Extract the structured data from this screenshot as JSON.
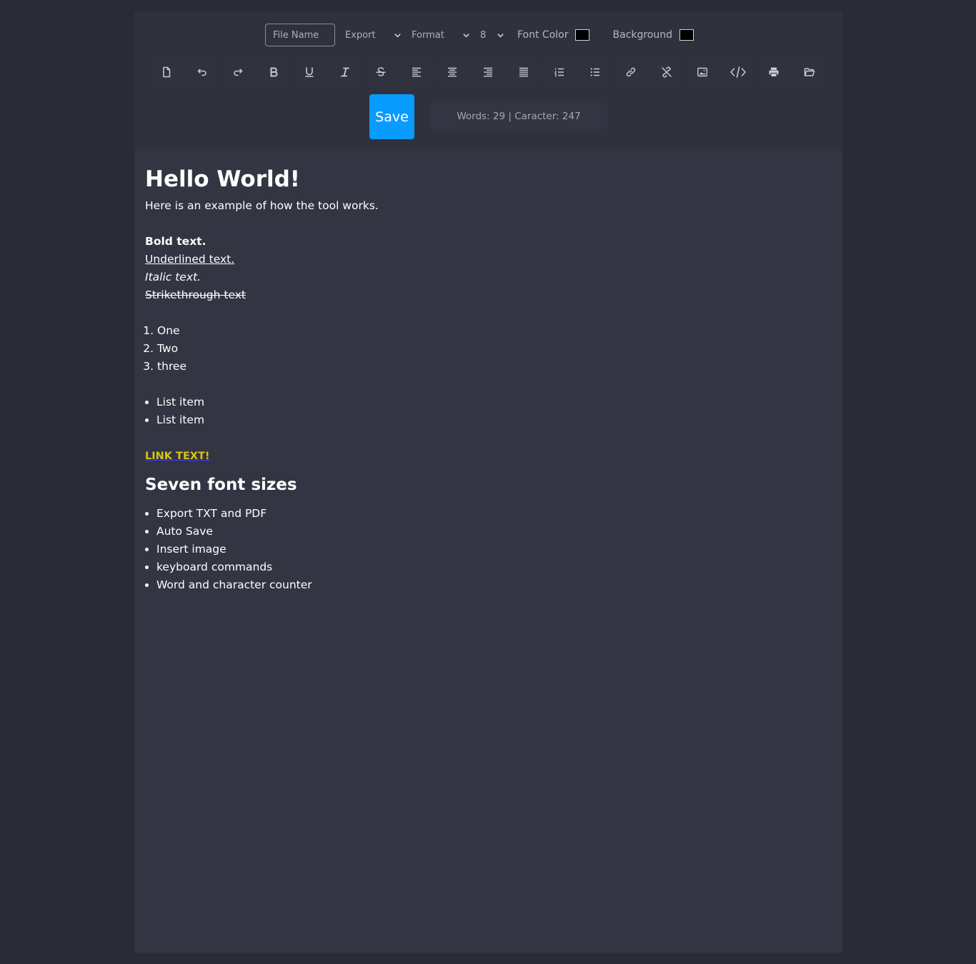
{
  "toolbar": {
    "file_name_placeholder": "File Name",
    "export_label": "Export",
    "format_label": "Format",
    "font_size_value": "8",
    "font_color_label": "Font Color",
    "font_color_value": "#000000",
    "background_label": "Background",
    "background_value": "#000000",
    "save_label": "Save",
    "counter_text": "Words: 29 | Caracter: 247"
  },
  "colors": {
    "page_bg": "#292b35",
    "panel_bg": "#333542",
    "accent": "#0a9bff",
    "link": "#d8c517"
  },
  "tool_icons": [
    "new-document-icon",
    "undo-icon",
    "redo-icon",
    "bold-icon",
    "underline-icon",
    "italic-icon",
    "strikethrough-icon",
    "align-left-icon",
    "align-center-icon",
    "align-right-icon",
    "align-justify-icon",
    "ordered-list-icon",
    "unordered-list-icon",
    "link-icon",
    "unlink-icon",
    "image-icon",
    "code-icon",
    "print-icon",
    "open-folder-icon"
  ],
  "editor": {
    "heading": "Hello World!",
    "intro": "Here is an example of how the tool works.",
    "bold": "Bold text.",
    "underlined": "Underlined text.",
    "italic": "Italic text.",
    "strike": "Strikethrough text",
    "ordered": [
      "One",
      "Two",
      "three"
    ],
    "unordered": [
      "List item",
      "List item"
    ],
    "link": "LINK TEXT!",
    "subheading": "Seven font sizes",
    "features": [
      "Export TXT and PDF",
      "Auto Save",
      "Insert image",
      "keyboard commands",
      "Word and character counter"
    ]
  }
}
